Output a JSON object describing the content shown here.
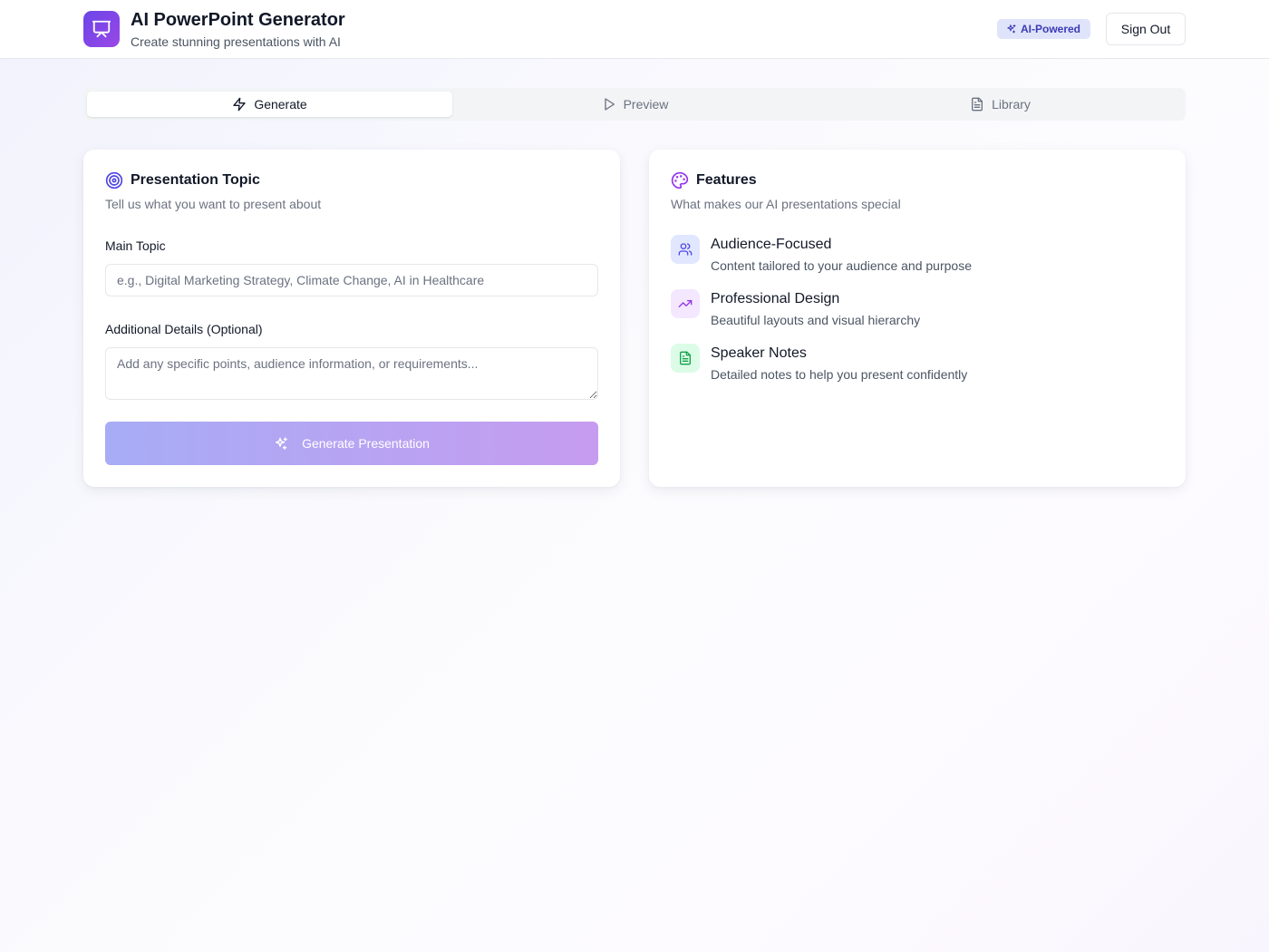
{
  "header": {
    "logo_icon": "presentation-icon",
    "title": "AI PowerPoint Generator",
    "subtitle": "Create stunning presentations with AI",
    "badge": {
      "icon": "sparkles-icon",
      "label": "AI-Powered"
    },
    "sign_out_label": "Sign Out"
  },
  "tabs": [
    {
      "icon": "zap-icon",
      "label": "Generate",
      "active": true
    },
    {
      "icon": "play-icon",
      "label": "Preview",
      "active": false
    },
    {
      "icon": "file-text-icon",
      "label": "Library",
      "active": false
    }
  ],
  "topic_card": {
    "icon": "target-icon",
    "title": "Presentation Topic",
    "description": "Tell us what you want to present about",
    "main_topic": {
      "label": "Main Topic",
      "value": "",
      "placeholder": "e.g., Digital Marketing Strategy, Climate Change, AI in Healthcare"
    },
    "details": {
      "label": "Additional Details (Optional)",
      "value": "",
      "placeholder": "Add any specific points, audience information, or requirements..."
    },
    "generate_button": {
      "icon": "sparkles-icon",
      "label": "Generate Presentation",
      "disabled": true
    }
  },
  "features_card": {
    "icon": "palette-icon",
    "title": "Features",
    "description": "What makes our AI presentations special",
    "items": [
      {
        "icon": "users-icon",
        "title": "Audience-Focused",
        "description": "Content tailored to your audience and purpose",
        "icon_bg": "#e0e7ff",
        "icon_color": "#4f46e5"
      },
      {
        "icon": "trending-up-icon",
        "title": "Professional Design",
        "description": "Beautiful layouts and visual hierarchy",
        "icon_bg": "#f3e8ff",
        "icon_color": "#9333ea"
      },
      {
        "icon": "file-text-icon",
        "title": "Speaker Notes",
        "description": "Detailed notes to help you present confidently",
        "icon_bg": "#dcfce7",
        "icon_color": "#16a34a"
      }
    ]
  },
  "colors": {
    "accent": "#6b46e8",
    "accent_secondary": "#9a47e6",
    "badge_bg": "#e0e4fb",
    "badge_text": "#3b3bb3"
  }
}
